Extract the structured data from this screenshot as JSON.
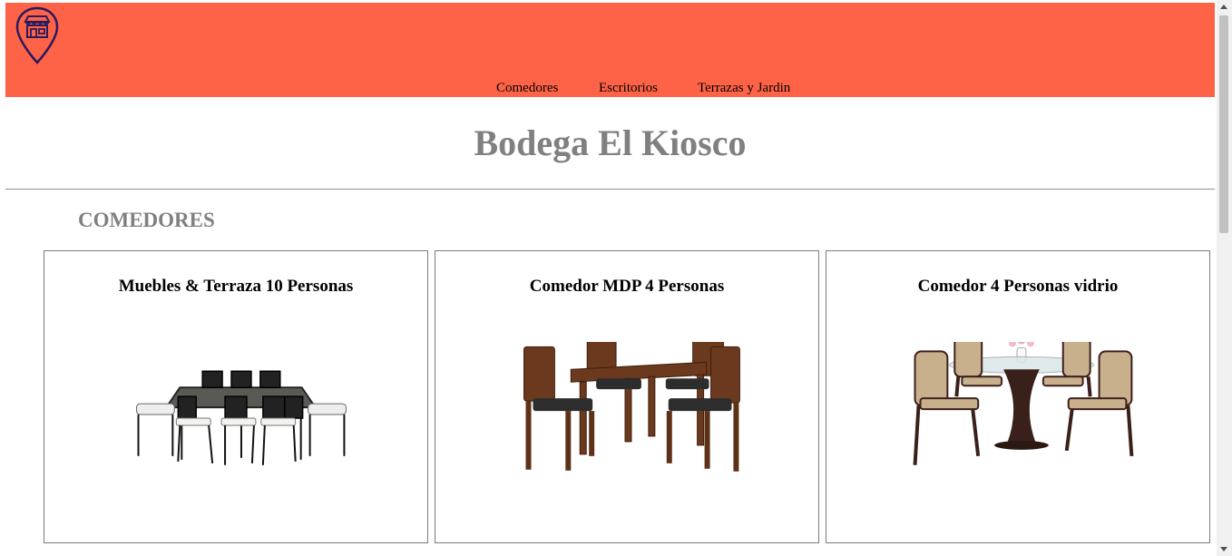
{
  "header": {
    "background": "#ff6347",
    "logo_icon": "store-pin-icon",
    "nav": [
      {
        "label": "Comedores"
      },
      {
        "label": "Escritorios"
      },
      {
        "label": "Terrazas y Jardin"
      }
    ]
  },
  "brand": {
    "title": "Bodega El Kiosco",
    "color": "#808080"
  },
  "section": {
    "title": "COMEDORES"
  },
  "products": [
    {
      "name": "Muebles & Terraza 10 Personas",
      "image_icon": "outdoor-dining-set-image"
    },
    {
      "name": "Comedor MDP 4 Personas",
      "image_icon": "wooden-dining-set-image"
    },
    {
      "name": "Comedor 4 Personas vidrio",
      "image_icon": "glass-dining-set-image"
    }
  ]
}
